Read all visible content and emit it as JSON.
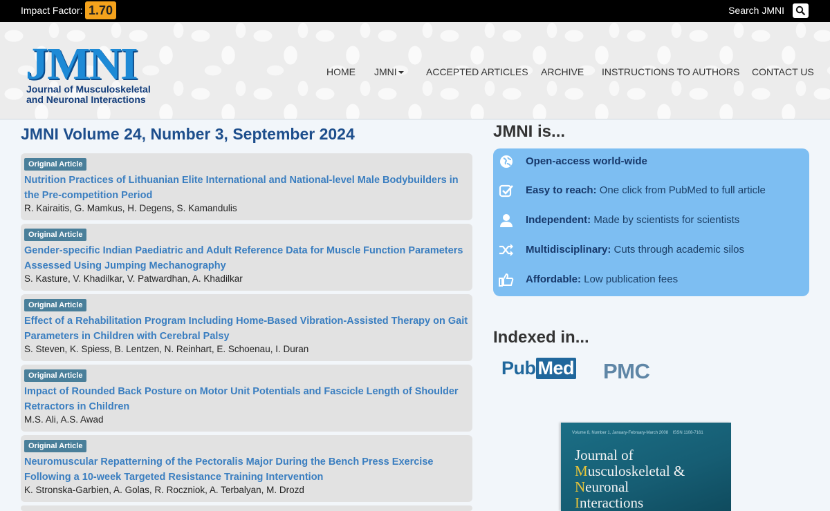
{
  "topbar": {
    "impact_label": "Impact Factor:",
    "impact_value": "1.70",
    "search_label": "Search JMNI",
    "search_icon": "search-icon"
  },
  "header": {
    "logo_text": "JMNI",
    "logo_subtitle_line1": "Journal of Musculoskeletal",
    "logo_subtitle_line2": "and Neuronal Interactions",
    "nav": [
      {
        "label": "HOME"
      },
      {
        "label": "JMNI",
        "has_dropdown": true
      },
      {
        "label": "ACCEPTED ARTICLES"
      },
      {
        "label": "ARCHIVE"
      },
      {
        "label": "INSTRUCTIONS TO AUTHORS"
      },
      {
        "label": "CONTACT US"
      }
    ]
  },
  "main": {
    "volume_title": "JMNI Volume 24, Number 3, September 2024",
    "articles": [
      {
        "badge": "Original Article",
        "title": "Nutrition Practices of Lithuanian Elite International and National-level Male Bodybuilders in the Pre-competition Period",
        "authors": "R. Kairaitis, G. Mamkus, H. Degens, S. Kamandulis"
      },
      {
        "badge": "Original Article",
        "title": "Gender-specific Indian Paediatric and Adult Reference Data for Muscle Function Parameters Assessed Using Jumping Mechanography",
        "authors": "S. Kasture, V. Khadilkar, V. Patwardhan, A. Khadilkar"
      },
      {
        "badge": "Original Article",
        "title": "Effect of a Rehabilitation Program Including Home-Based Vibration-Assisted Therapy on Gait Parameters in Children with Cerebral Palsy",
        "authors": "S. Steven, K. Spiess, B. Lentzen, N. Reinhart, E. Schoenau, I. Duran"
      },
      {
        "badge": "Original Article",
        "title": "Impact of Rounded Back Posture on Motor Unit Potentials and Fascicle Length of Shoulder Retractors in Children",
        "authors": "M.S. Ali, A.S. Awad"
      },
      {
        "badge": "Original Article",
        "title": "Neuromuscular Repatterning of the Pectoralis Major During the Bench Press Exercise Following a 10-week Targeted Resistance Training Intervention",
        "authors": "K. Stronska-Garbien, A. Golas, R. Roczniok, A. Terbalyan, M. Drozd"
      }
    ]
  },
  "sidebar": {
    "jmni_is_heading": "JMNI is...",
    "features": [
      {
        "icon": "globe-icon",
        "bold": "Open-access world-wide",
        "text": ""
      },
      {
        "icon": "checkbox-icon",
        "bold": "Easy to reach:",
        "text": "One click from PubMed to full article"
      },
      {
        "icon": "person-icon",
        "bold": "Independent:",
        "text": "Made by scientists for scientists"
      },
      {
        "icon": "shuffle-icon",
        "bold": "Multidisciplinary:",
        "text": "Cuts through academic silos"
      },
      {
        "icon": "thumbs-up-icon",
        "bold": "Affordable:",
        "text": "Low publication fees"
      }
    ],
    "indexed_heading": "Indexed in...",
    "indexed_logos": {
      "pubmed_part1": "Pub",
      "pubmed_part2": "Med",
      "pmc": "PMC"
    },
    "cover": {
      "meta_left": "Volume 8, Number 1, January-February-March 2008",
      "meta_right": "ISSN 1108-7161",
      "line1": "Journal of",
      "line2_initial": "M",
      "line2_rest": "usculoskeletal &",
      "line3_initial": "N",
      "line3_rest": "euronal",
      "line4_initial": "I",
      "line4_rest": "nteractions"
    }
  },
  "colors": {
    "accent_blue": "#3a7ec0",
    "impact_badge": "#f4a21c",
    "features_bg": "#7dbef2",
    "badge_bg": "#4a7f9a"
  }
}
